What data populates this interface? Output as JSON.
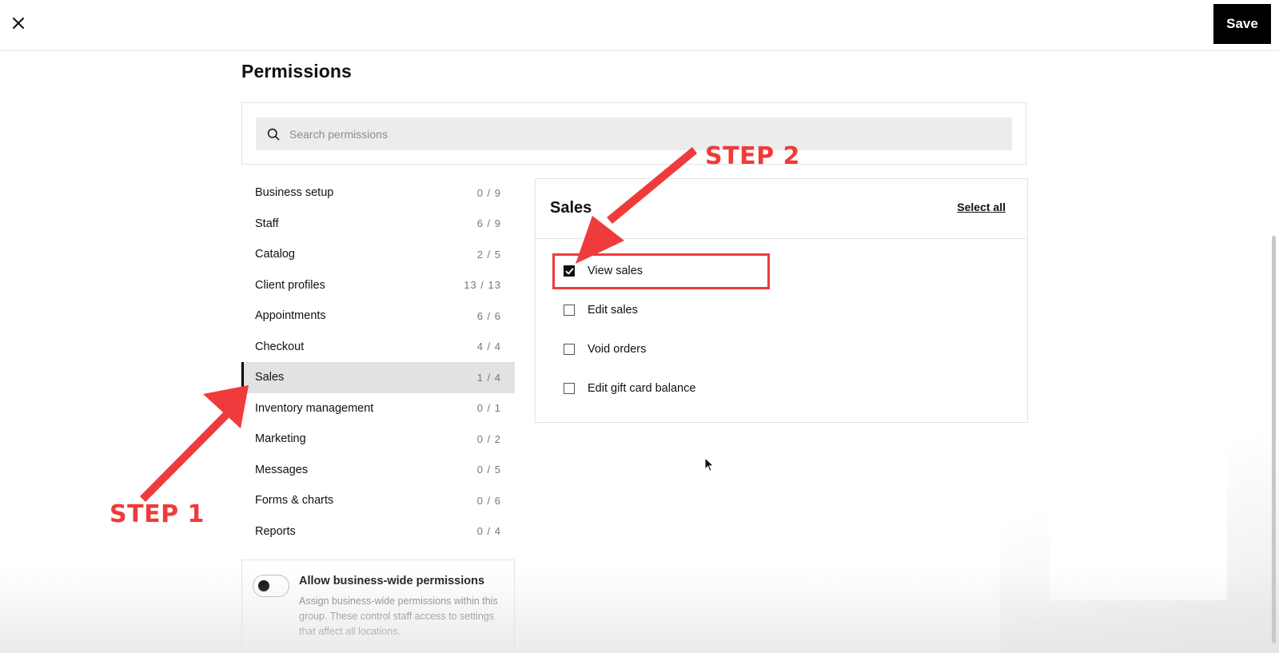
{
  "topbar": {
    "save_label": "Save"
  },
  "page_title": "Permissions",
  "search": {
    "placeholder": "Search permissions",
    "value": ""
  },
  "categories": [
    {
      "label": "Business setup",
      "count": "0 / 9"
    },
    {
      "label": "Staff",
      "count": "6 / 9"
    },
    {
      "label": "Catalog",
      "count": "2 / 5"
    },
    {
      "label": "Client profiles",
      "count": "13 / 13"
    },
    {
      "label": "Appointments",
      "count": "6 / 6"
    },
    {
      "label": "Checkout",
      "count": "4 / 4"
    },
    {
      "label": "Sales",
      "count": "1 / 4",
      "active": true
    },
    {
      "label": "Inventory management",
      "count": "0 / 1"
    },
    {
      "label": "Marketing",
      "count": "0 / 2"
    },
    {
      "label": "Messages",
      "count": "0 / 5"
    },
    {
      "label": "Forms & charts",
      "count": "0 / 6"
    },
    {
      "label": "Reports",
      "count": "0 / 4"
    }
  ],
  "business_wide": {
    "toggle_on": false,
    "title": "Allow business-wide permissions",
    "description": "Assign business-wide permissions within this group. These control staff access to settings that affect all locations."
  },
  "sales_panel": {
    "title": "Sales",
    "select_all_label": "Select all",
    "permissions": [
      {
        "label": "View sales",
        "checked": true
      },
      {
        "label": "Edit sales",
        "checked": false
      },
      {
        "label": "Void orders",
        "checked": false
      },
      {
        "label": "Edit gift card balance",
        "checked": false
      }
    ]
  },
  "annotations": {
    "step1": "STEP 1",
    "step2": "STEP 2",
    "color": "#ef3b3b"
  },
  "icons": {
    "close": "close-icon",
    "search": "search-icon",
    "checkmark": "checkmark-icon",
    "cursor": "mouse-cursor-icon"
  }
}
